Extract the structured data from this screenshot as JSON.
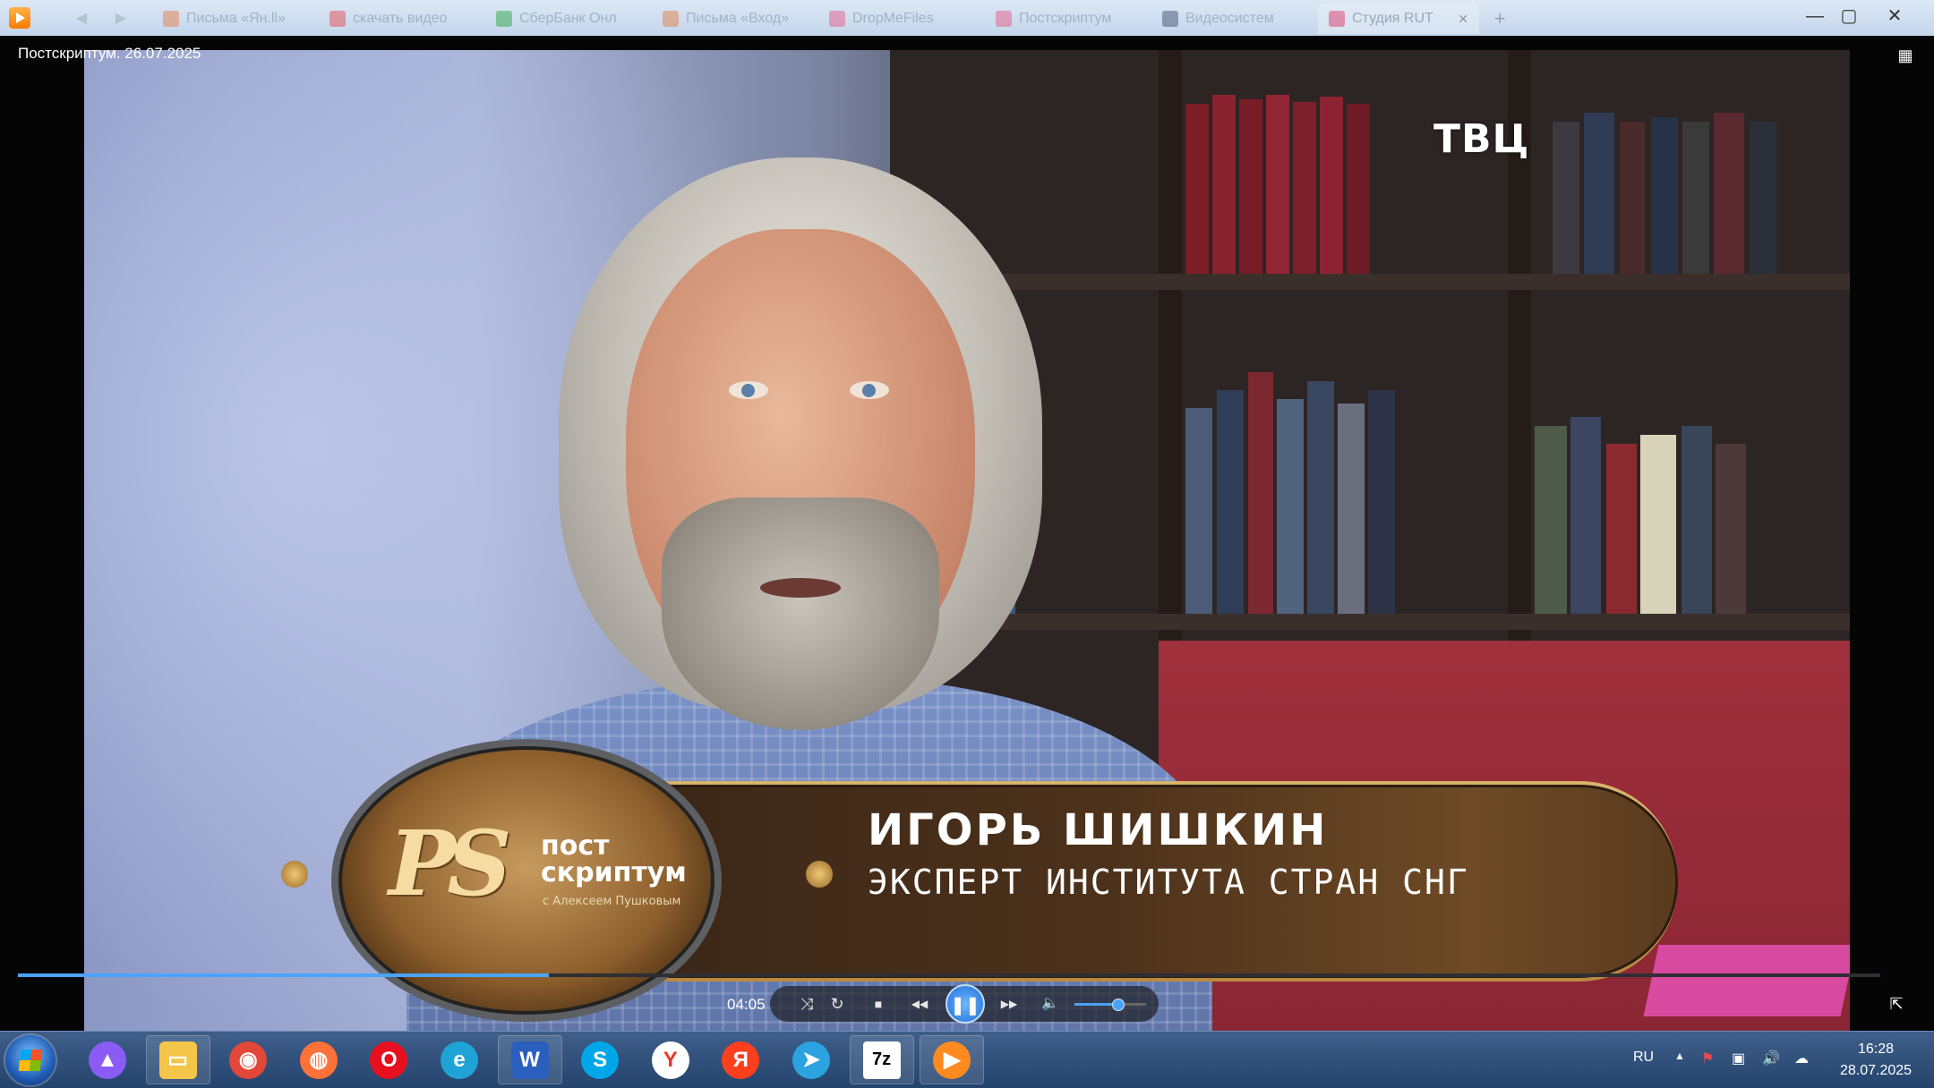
{
  "browser": {
    "tabs": [
      {
        "label": "Письма «Ян.ll»",
        "icon": "gmail-icon",
        "color": "#e8743b"
      },
      {
        "label": "скачать видео",
        "icon": "red-circle-icon",
        "color": "#e84040"
      },
      {
        "label": "СберБанк Онл",
        "icon": "sber-icon",
        "color": "#21a038"
      },
      {
        "label": "Письма «Вход»",
        "icon": "gmail-icon",
        "color": "#e8743b"
      },
      {
        "label": "DropMeFiles",
        "icon": "dropme-icon",
        "color": "#e84f7a"
      },
      {
        "label": "Постскриптум",
        "icon": "tv-icon",
        "color": "#e84f7a"
      },
      {
        "label": "Видеосистем",
        "icon": "video-icon",
        "color": "#334466"
      },
      {
        "label": "Студия RUT",
        "icon": "rutube-icon",
        "color": "#e84f7a",
        "active": true
      }
    ],
    "add_tab": "+"
  },
  "window_controls": {
    "minimize": "—",
    "maximize": "▢",
    "close": "✕"
  },
  "player": {
    "video_title": "Постскриптум. 26.07.2025",
    "channel_logo": "ТВЦ",
    "lower_third": {
      "show_mark": "PS",
      "show_title_line1": "пост",
      "show_title_line2": "скриптум",
      "show_subtitle": "с Алексеем Пушковым",
      "person_name": "ИГОРЬ ШИШКИН",
      "person_role": "ЭКСПЕРТ ИНСТИТУТА СТРАН СНГ"
    },
    "progress_fraction": 0.285,
    "current_time": "04:05",
    "volume_fraction": 0.6,
    "controls": {
      "shuffle": "⤨",
      "repeat": "↻",
      "stop": "■",
      "rewind": "◀◀",
      "pause": "❚❚",
      "forward": "▶▶",
      "mute": "🔈"
    },
    "corner_menu": "▦",
    "fullscreen": "⇱"
  },
  "taskbar": {
    "apps": [
      {
        "name": "alice-icon",
        "color": "#8a5cf5",
        "glyph": "▲"
      },
      {
        "name": "explorer-icon",
        "color": "#f3c64a",
        "glyph": "▭"
      },
      {
        "name": "chrome-icon",
        "color": "#e3473a",
        "glyph": "◉"
      },
      {
        "name": "firefox-icon",
        "color": "#ff7139",
        "glyph": "◍"
      },
      {
        "name": "opera-icon",
        "color": "#e6101f",
        "glyph": "O"
      },
      {
        "name": "edge-icon",
        "color": "#1fa3d6",
        "glyph": "e"
      },
      {
        "name": "word-icon",
        "color": "#2b5fbd",
        "glyph": "W"
      },
      {
        "name": "skype-icon",
        "color": "#00a7e8",
        "glyph": "S"
      },
      {
        "name": "yandex-browser-icon",
        "color": "#ffffff",
        "glyph": "Y"
      },
      {
        "name": "yandex-icon",
        "color": "#fc3f1d",
        "glyph": "Я"
      },
      {
        "name": "telegram-icon",
        "color": "#2aa3e0",
        "glyph": "➤"
      },
      {
        "name": "7zip-icon",
        "color": "#ffffff",
        "glyph": "7z"
      },
      {
        "name": "player-icon",
        "color": "#ff8a1f",
        "glyph": "▶"
      }
    ],
    "language": "RU",
    "clock_time": "16:28",
    "clock_date": "28.07.2025",
    "tray_icons": [
      "show-hidden-icon",
      "flag-icon",
      "network-icon",
      "volume-icon",
      "cloud-icon"
    ]
  }
}
